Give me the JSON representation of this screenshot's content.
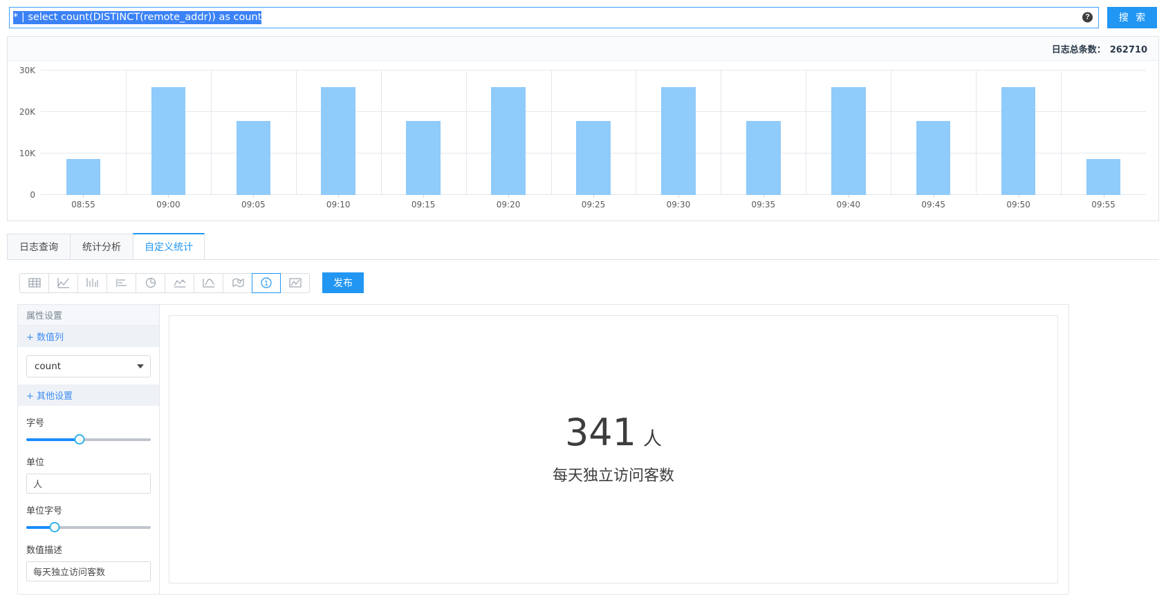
{
  "search": {
    "query": "* | select count(DISTINCT(remote_addr)) as count",
    "help_icon": "question-mark-icon",
    "button_label": "搜 索"
  },
  "chart_panel": {
    "log_total_label": "日志总条数：",
    "log_total_value": "262710"
  },
  "chart_data": {
    "type": "bar",
    "title": "",
    "xlabel": "",
    "ylabel": "",
    "categories": [
      "08:55",
      "09:00",
      "09:05",
      "09:10",
      "09:15",
      "09:20",
      "09:25",
      "09:30",
      "09:35",
      "09:40",
      "09:45",
      "09:50",
      "09:55"
    ],
    "values": [
      8600,
      26000,
      17800,
      26000,
      17800,
      26000,
      17800,
      26000,
      17800,
      26000,
      17800,
      26000,
      8600
    ],
    "ytick_labels": [
      "0",
      "10K",
      "20K",
      "30K"
    ],
    "ytick_values": [
      0,
      10000,
      20000,
      30000
    ],
    "ylim": [
      0,
      30000
    ],
    "grid": true,
    "legend": "none",
    "bar_color": "#8fcbfb"
  },
  "tabs": [
    {
      "label": "日志查询",
      "active": false
    },
    {
      "label": "统计分析",
      "active": false
    },
    {
      "label": "自定义统计",
      "active": true
    }
  ],
  "toolbar": {
    "icons": [
      {
        "name": "table-icon",
        "active": false
      },
      {
        "name": "line-chart-icon",
        "active": false
      },
      {
        "name": "column-chart-icon",
        "active": false
      },
      {
        "name": "bar-chart-icon",
        "active": false
      },
      {
        "name": "pie-chart-icon",
        "active": false
      },
      {
        "name": "area-chart-icon",
        "active": false
      },
      {
        "name": "curve-chart-icon",
        "active": false
      },
      {
        "name": "map-chart-icon",
        "active": false
      },
      {
        "name": "single-value-icon",
        "active": true
      },
      {
        "name": "gauge-chart-icon",
        "active": false
      }
    ],
    "publish_label": "发布"
  },
  "properties": {
    "title": "属性设置",
    "value_column_section": "+ 数值列",
    "value_column_selected": "count",
    "other_settings_section": "+ 其他设置",
    "font_size_label": "字号",
    "font_size_percent": 43,
    "unit_label": "单位",
    "unit_value": "人",
    "unit_font_size_label": "单位字号",
    "unit_font_size_percent": 23,
    "value_desc_label": "数值描述",
    "value_desc_value": "每天独立访问客数"
  },
  "preview": {
    "value": "341",
    "unit": "人",
    "description": "每天独立访问客数"
  }
}
